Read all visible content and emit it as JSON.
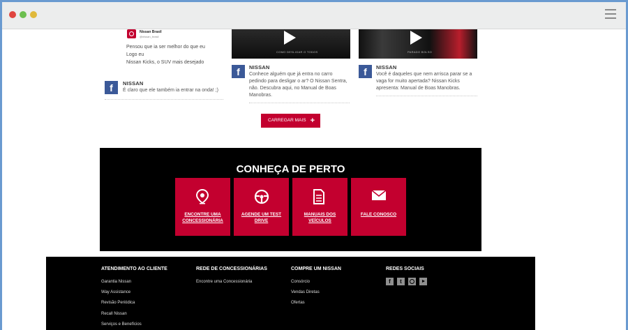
{
  "window": {
    "dots": {
      "red": "#e0453f",
      "yellow": "#e0b93b",
      "green": "#6cbf4f"
    },
    "menu_icon": "hamburger-icon"
  },
  "feed": {
    "left": {
      "embed_brand": "Nissan Brasil",
      "embed_handle": "@nissan_brasil",
      "text_lines": [
        "Pensou que ia ser melhor do que eu",
        "Logo eu",
        "Nissan Kicks, o SUV mais desejado"
      ],
      "post_author": "NISSAN",
      "post_text": "É claro que ele também ia entrar na onda! ;)"
    },
    "middle": {
      "video_caption": "COMO DESLIGAR O TODOS",
      "post_author": "NISSAN",
      "post_text_lines": [
        "Conhece alguém que já entra no carro",
        "pedindo para desligar o ar? O Nissan Sentra,",
        "não. Descubra aqui, no Manual de Boas",
        "Manobras."
      ]
    },
    "right": {
      "video_caption": "PARADO BOLSO",
      "post_author": "NISSAN",
      "post_text_lines": [
        "Você é daqueles que nem arrisca parar se a",
        "vaga for muito apertada? Nissan Kicks",
        "apresenta: Manual de Boas Manobras."
      ]
    },
    "load_more_label": "CARREGAR MAIS",
    "load_more_icon": "plus-icon"
  },
  "discover": {
    "title": "CONHEÇA DE PERTO",
    "tiles": [
      {
        "label": "ENCONTRE UMA CONCESSIONÁRIA",
        "icon": "location-pin-icon"
      },
      {
        "label": "AGENDE UM TEST DRIVE",
        "icon": "steering-wheel-icon"
      },
      {
        "label": "MANUAIS DOS VEÍCULOS",
        "icon": "document-icon"
      },
      {
        "label": "FALE CONOSCO",
        "icon": "envelope-icon"
      }
    ]
  },
  "footer": {
    "col1": {
      "heading": "ATENDIMENTO AO CLIENTE",
      "links": [
        "Garantia Nissan",
        "Way Assistance",
        "Revisão Periódica",
        "Recall Nissan",
        "Serviços e Benefícios"
      ]
    },
    "col2": {
      "heading": "REDE DE CONCESSIONÁRIAS",
      "links": [
        "Encontre uma Concessionária"
      ]
    },
    "col3": {
      "heading": "COMPRE UM NISSAN",
      "links": [
        "Consórcio",
        "Vendas Diretas",
        "Ofertas"
      ]
    },
    "col4": {
      "heading": "REDES SOCIAIS",
      "icons": [
        "facebook-icon",
        "twitter-icon",
        "instagram-icon",
        "youtube-icon"
      ]
    }
  },
  "colors": {
    "brand_red": "#c3002f",
    "facebook_blue": "#3b5998"
  }
}
